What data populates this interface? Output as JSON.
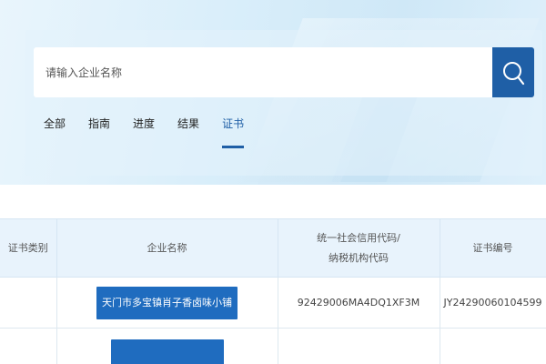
{
  "search": {
    "placeholder": "请输入企业名称",
    "button_icon": "search-icon"
  },
  "tabs": [
    {
      "label": "全部",
      "active": false
    },
    {
      "label": "指南",
      "active": false
    },
    {
      "label": "进度",
      "active": false
    },
    {
      "label": "结果",
      "active": false
    },
    {
      "label": "证书",
      "active": true
    }
  ],
  "table": {
    "headers": [
      "证书类别",
      "企业名称",
      "统一社会信用代码/",
      "纳税机构代码",
      "证书编号"
    ],
    "rows": [
      {
        "category": "",
        "company": "天门市多宝镇肖子香卤味小铺",
        "credit_code": "92429006MA4DQ1XF3M",
        "cert_no": "JY24290060104599"
      },
      {
        "category": "",
        "company": "",
        "credit_code": "",
        "cert_no": ""
      }
    ]
  },
  "colors": {
    "accent": "#1f5fa6",
    "button": "#1f6cbf",
    "header_bg": "#e8f3fc"
  }
}
